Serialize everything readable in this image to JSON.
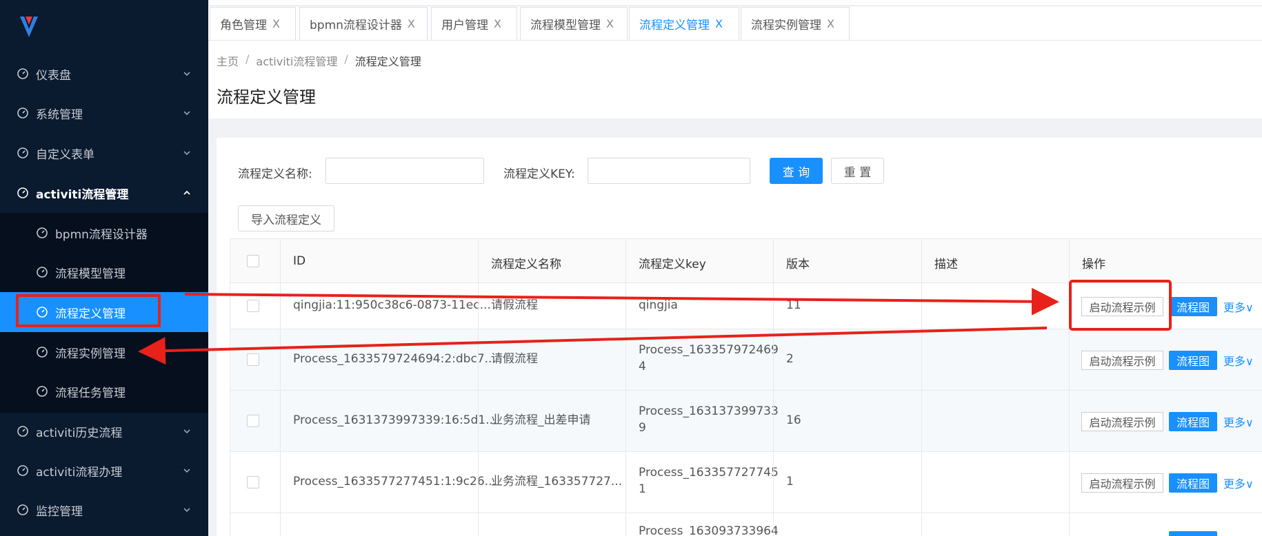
{
  "sidebar": {
    "items": [
      {
        "label": "仪表盘"
      },
      {
        "label": "系统管理"
      },
      {
        "label": "自定义表单"
      },
      {
        "label": "activiti流程管理"
      },
      {
        "label": "bpmn流程设计器"
      },
      {
        "label": "流程模型管理"
      },
      {
        "label": "流程定义管理"
      },
      {
        "label": "流程实例管理"
      },
      {
        "label": "流程任务管理"
      },
      {
        "label": "activiti历史流程"
      },
      {
        "label": "activiti流程办理"
      },
      {
        "label": "监控管理"
      }
    ]
  },
  "tabs": [
    {
      "label": "角色管理"
    },
    {
      "label": "bpmn流程设计器"
    },
    {
      "label": "用户管理"
    },
    {
      "label": "流程模型管理"
    },
    {
      "label": "流程定义管理"
    },
    {
      "label": "流程实例管理"
    }
  ],
  "tab_close": "X",
  "breadcrumb": {
    "home": "主页",
    "sep": "/",
    "parent": "activiti流程管理",
    "current": "流程定义管理"
  },
  "page_title": "流程定义管理",
  "search": {
    "name_label": "流程定义名称:",
    "name_value": "",
    "key_label": "流程定义KEY:",
    "key_value": "",
    "query_label": "查 询",
    "reset_label": "重 置"
  },
  "import_label": "导入流程定义",
  "table": {
    "headers": [
      "ID",
      "流程定义名称",
      "流程定义key",
      "版本",
      "描述",
      "操作"
    ],
    "rows": [
      {
        "id": "qingjia:11:950c38c6-0873-11ec...",
        "name": "请假流程",
        "key_1": "qingjia",
        "key_2": "",
        "version": "11",
        "desc": ""
      },
      {
        "id": "Process_1633579724694:2:dbc7...",
        "name": "请假流程",
        "key_1": "Process_163357972469",
        "key_2": "4",
        "version": "2",
        "desc": ""
      },
      {
        "id": "Process_1631373997339:16:5d1...",
        "name": "业务流程_出差申请",
        "key_1": "Process_163137399733",
        "key_2": "9",
        "version": "16",
        "desc": ""
      },
      {
        "id": "Process_1633577277451:1:9c26...",
        "name": "业务流程_163357727...",
        "key_1": "Process_163357727745",
        "key_2": "1",
        "version": "1",
        "desc": ""
      },
      {
        "id": "",
        "name": "",
        "key_1": "Process_163093733964",
        "key_2": "",
        "version": "",
        "desc": ""
      }
    ],
    "op_start": "启动流程示例",
    "op_diagram": "流程图",
    "op_more": "更多"
  },
  "colors": {
    "sidebar_bg": "#0a1a2f",
    "accent": "#1890ff",
    "annotation": "#e8211a"
  }
}
